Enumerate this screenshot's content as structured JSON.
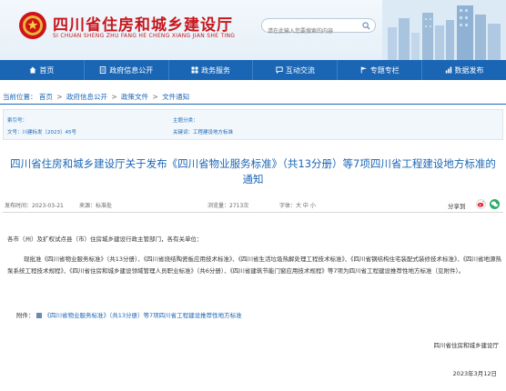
{
  "header": {
    "title": "四川省住房和城乡建设厅",
    "subtitle": "SI CHUAN SHENG ZHU FANG HE CHENG XIANG JIAN SHE TING",
    "search_placeholder": "请在此输入您要搜索的内容"
  },
  "nav": {
    "items": [
      {
        "label": "首页",
        "icon": "home-icon"
      },
      {
        "label": "政府信息公开",
        "icon": "document-icon"
      },
      {
        "label": "政务服务",
        "icon": "grid-icon"
      },
      {
        "label": "互动交流",
        "icon": "chat-icon"
      },
      {
        "label": "专题专栏",
        "icon": "flag-icon"
      },
      {
        "label": "数据发布",
        "icon": "chart-icon"
      }
    ]
  },
  "breadcrumb": {
    "label": "当前位置：",
    "items": [
      "首页",
      "政府信息公开",
      "政策文件",
      "文件通知"
    ],
    "separator": ">"
  },
  "meta": {
    "index_label": "索引号：",
    "index_value": "",
    "subject_label": "主题分类：",
    "subject_value": "",
    "docno_label": "文号：",
    "docno_value": "川建标发〔2023〕45号",
    "keywords_label": "关键词：",
    "keywords_value": "工程建设地方标准"
  },
  "document": {
    "title": "四川省住房和城乡建设厅关于发布《四川省物业服务标准》（共13分册）等7项四川省工程建设地方标准的通知",
    "publish_time": "发布时间：2023-03-21",
    "source": "来源：标准处",
    "views": "浏览量：2713次",
    "font_size": "字体：大 中 小",
    "share_label": "分享到",
    "salutation": "各市（州）及扩权试点县（市）住房城乡建设行政主管部门，各有关单位：",
    "main_paragraph": "现批准《四川省物业服务标准》（共13分册）、《四川省烧结陶瓷板应用技术标准》、《四川省生活垃圾热解处理工程技术标准》、《四川省钢结构住宅装配式装修技术标准》、《四川省地源热泵系统工程技术规程》、《四川省住房和城乡建设领域管理人员职业标准》（共6分册）、《四川省建筑节能门窗应用技术规程》等7项为四川省工程建设推荐性地方标准（见附件）。",
    "attachment_label": "附件：",
    "attachment_link": "《四川省物业服务标准》（共13分册）等7项四川省工程建设推荐性地方标准",
    "signature_org": "四川省住房和城乡建设厅",
    "signature_date": "2023年3月12日"
  },
  "colors": {
    "brand_red": "#c8161d",
    "nav_blue": "#1a66b5",
    "link_blue": "#1a66b5"
  }
}
